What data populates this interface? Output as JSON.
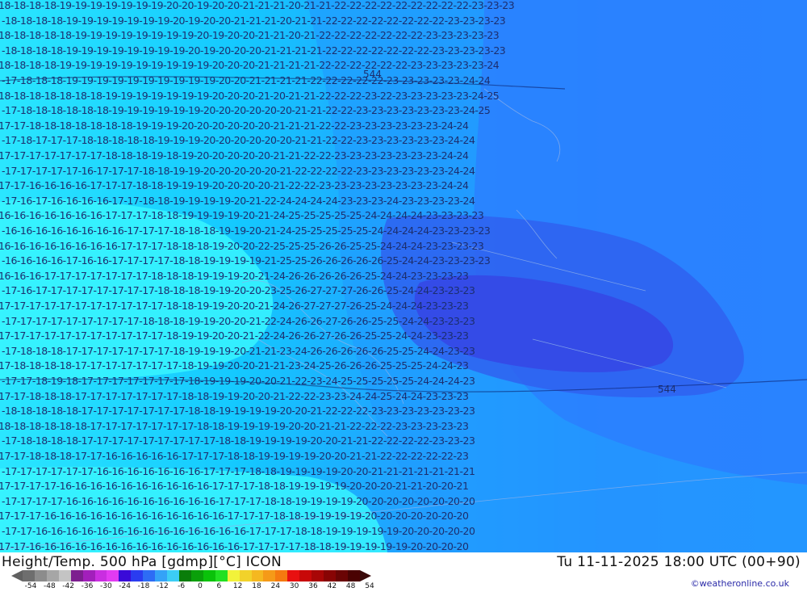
{
  "map": {
    "title": "Height/Temp. 500 hPa [gdmp][°C] ICON",
    "valid_time": "Tu 11-11-2025 18:00 UTC (00+90)",
    "credit": "©weatheronline.co.uk",
    "rows": [
      "-18-18-18-18-19-19-19-19-19-19-19-20-20-19-20-20-21-21-21-20-21-21-22-22-22-22-22-22-22-22-22-23-23-23",
      "-18-18-18-18-19-19-19-19-19-19-19-20-19-20-20-21-21-21-20-21-21-22-22-22-22-22-22-22-22-23-23-23-23",
      "-18-18-18-18-18-19-19-19-19-19-19-19-19-20-19-20-20-21-21-20-21-22-22-22-22-22-22-22-23-23-23-23-23",
      "-18-18-18-18-19-19-19-19-19-19-19-19-20-19-20-20-20-21-21-21-21-22-22-22-22-22-22-22-23-23-23-23-23",
      "-18-18-18-18-19-19-19-19-19-19-19-19-19-19-20-20-20-21-21-21-21-22-22-22-22-22-22-23-23-23-23-23-24",
      "-17-18-18-18-19-19-19-19-19-19-19-19-19-19-20-20-21-21-21-21-22-22-22-22-22-23-23-23-23-23-24-24",
      "-18-18-18-18-18-18-18-19-19-19-19-19-19-19-20-20-20-21-20-21-21-22-22-22-23-22-23-23-23-23-23-24-25",
      "-17-18-18-18-18-18-18-19-19-19-19-19-19-20-20-20-20-20-20-21-21-22-22-23-23-23-23-23-23-23-24-25",
      "-17-17-18-18-18-18-18-18-18-19-19-19-20-20-20-20-20-20-21-21-21-22-22-23-23-23-23-23-23-24-24",
      "-17-18-17-17-17-18-18-18-18-18-19-19-19-20-20-20-20-20-20-21-21-22-22-23-23-23-23-23-23-24-24",
      "-17-17-17-17-17-17-17-18-18-18-19-18-19-20-20-20-20-20-21-21-22-22-23-23-23-23-23-23-23-24-24",
      "-17-17-17-17-17-16-17-17-17-18-18-19-19-20-20-20-20-20-21-22-22-22-22-23-23-23-23-23-23-24-24",
      "-17-17-16-16-16-16-17-17-17-18-18-19-19-19-20-20-20-20-21-22-22-23-23-23-23-23-23-23-23-24-24",
      "-17-16-17-16-16-16-16-17-17-18-18-19-19-19-19-20-21-22-24-24-24-24-23-23-23-24-23-23-23-23-24",
      "-16-16-16-16-16-16-16-17-17-17-18-18-19-19-19-19-20-21-24-25-25-25-25-25-24-24-24-24-23-23-23-23",
      "-16-16-16-16-16-16-16-16-17-17-17-18-18-18-19-19-20-21-24-25-25-25-25-25-24-24-24-24-23-23-23-23",
      "-16-16-16-16-16-16-16-16-17-17-17-18-18-18-19-20-20-22-25-25-25-26-26-25-25-24-24-24-23-23-23-23",
      "-16-16-16-16-17-16-16-17-17-17-17-18-18-19-19-19-19-21-25-25-26-26-26-26-26-25-24-24-23-23-23-23",
      "-16-16-16-17-17-17-17-17-17-17-18-18-18-19-19-19-20-21-24-26-26-26-26-26-25-24-24-23-23-23-23",
      "-17-16-17-17-17-17-17-17-17-17-18-18-18-19-19-20-20-23-25-26-27-27-27-26-26-25-24-24-23-23-23",
      "-17-17-17-17-17-17-17-17-17-17-17-18-18-19-19-20-20-21-24-26-27-27-27-26-25-24-24-24-23-23-23",
      "-17-17-17-17-17-17-17-17-17-18-18-18-19-19-20-20-21-22-24-26-26-27-26-26-25-25-24-24-23-23-23",
      "-17-17-17-17-17-17-17-17-17-17-17-18-19-19-20-20-21-22-24-26-26-27-26-26-25-25-24-24-23-23-23",
      "-17-18-18-18-17-17-17-17-17-17-17-18-19-19-19-20-21-21-23-24-26-26-26-26-26-25-25-24-24-23-23",
      "-17-18-18-18-18-17-17-17-17-17-17-17-18-19-19-20-20-21-21-23-24-25-26-26-26-25-25-25-24-24-23",
      "-17-17-18-19-18-17-17-17-17-17-17-17-18-19-19-19-20-20-21-22-23-24-25-25-25-25-25-24-24-24-23",
      "-17-17-18-18-18-17-17-17-17-17-17-17-18-18-19-19-20-20-21-22-22-23-23-24-24-25-24-24-23-23-23",
      "-18-18-18-18-18-17-17-17-17-17-17-17-18-18-19-19-19-19-20-20-21-22-22-22-23-23-23-23-23-23-23",
      "-18-18-18-18-18-18-17-17-17-17-17-17-17-18-18-19-19-19-19-20-20-21-21-22-22-22-23-23-23-23-23",
      "-17-18-18-18-18-17-17-17-17-17-17-17-17-17-18-18-19-19-19-19-20-20-21-21-22-22-22-22-23-23-23",
      "-17-17-18-18-18-17-17-16-16-16-16-16-17-17-17-18-18-19-19-19-19-20-20-21-21-22-22-22-22-22-23",
      "-17-17-17-17-17-17-16-16-16-16-16-16-16-17-17-17-18-18-19-19-19-19-20-20-21-21-21-21-21-21-21",
      "-17-17-17-17-16-16-16-16-16-16-16-16-16-16-17-17-17-18-18-19-19-19-19-20-20-20-21-21-20-20-21",
      "-17-17-17-17-16-16-16-16-16-16-16-16-16-16-17-17-17-18-18-19-19-19-19-20-20-20-20-20-20-20-20",
      "-17-17-17-16-16-16-16-16-16-16-16-16-16-16-16-17-17-17-18-18-19-19-19-19-20-20-20-20-20-20-20",
      "-17-17-16-16-16-16-16-16-16-16-16-16-16-16-16-16-17-17-17-18-18-19-19-19-19-19-20-20-20-20-20",
      "-17-17-16-16-16-16-16-16-16-16-16-16-16-16-16-16-17-17-17-17-18-18-19-19-19-19-19-20-20-20-20"
    ],
    "highs_lows": [
      {
        "label": "544"
      },
      {
        "label": "544"
      }
    ]
  },
  "legend": {
    "colors": [
      "#6e6e6e",
      "#8c8c8c",
      "#a6a6a6",
      "#c4c4c4",
      "#7d1f8f",
      "#a21fbb",
      "#c92ee0",
      "#e23bf2",
      "#3a0ad8",
      "#2a3cf0",
      "#2d6cf5",
      "#34a2f7",
      "#3ccdf5",
      "#0a7d0a",
      "#0aa00a",
      "#0ac20a",
      "#22e022",
      "#f2f23a",
      "#f2d22a",
      "#f5b820",
      "#f59a18",
      "#f57a10",
      "#e81010",
      "#c80808",
      "#a80606",
      "#880404",
      "#6a0404",
      "#4a0202"
    ],
    "ticks": [
      "-54",
      "-48",
      "-42",
      "-36",
      "-30",
      "-24",
      "-18",
      "-12",
      "-6",
      "0",
      "6",
      "12",
      "18",
      "24",
      "30",
      "36",
      "42",
      "48",
      "54"
    ]
  }
}
